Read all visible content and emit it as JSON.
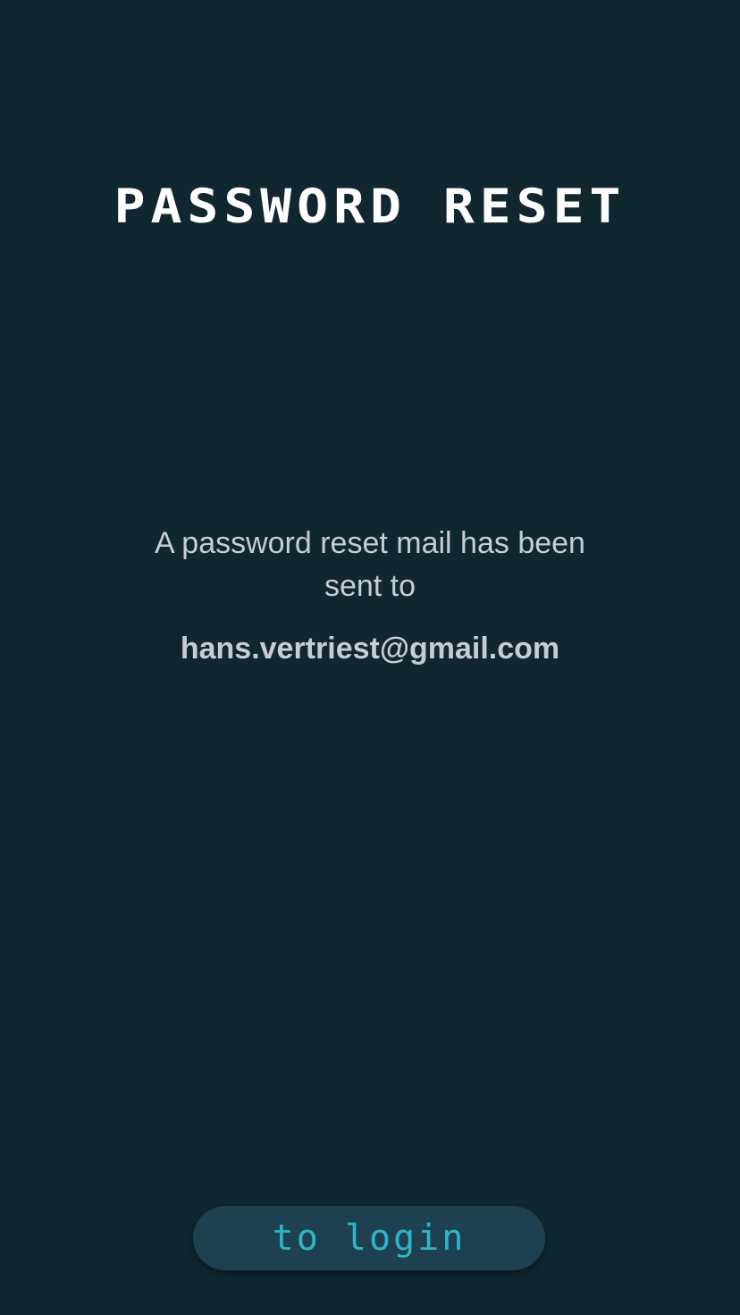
{
  "page": {
    "title": "PASSWORD RESET",
    "message": "A password reset mail has been sent to",
    "email": "hans.vertriest@gmail.com"
  },
  "actions": {
    "login_label": "to login"
  },
  "colors": {
    "background": "#10272f",
    "title": "#ffffff",
    "text": "#c7cdd0",
    "button_bg": "#1d4150",
    "button_text": "#2fb5c6"
  }
}
